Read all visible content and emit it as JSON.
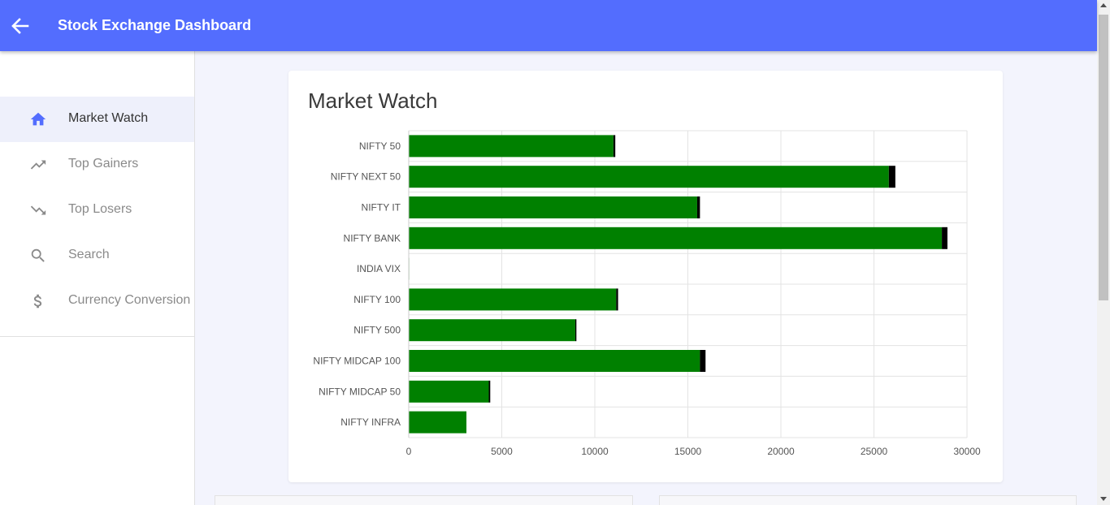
{
  "header": {
    "title": "Stock Exchange Dashboard",
    "back_icon": "arrow-left-icon"
  },
  "sidebar": {
    "items": [
      {
        "label": "Market Watch",
        "icon": "home-icon",
        "active": true
      },
      {
        "label": "Top Gainers",
        "icon": "trending-up-icon",
        "active": false
      },
      {
        "label": "Top Losers",
        "icon": "trending-down-icon",
        "active": false
      },
      {
        "label": "Search",
        "icon": "search-icon",
        "active": false
      },
      {
        "label": "Currency Conversion",
        "icon": "dollar-icon",
        "active": false
      }
    ]
  },
  "main": {
    "card_title": "Market Watch"
  },
  "colors": {
    "primary": "#536dfe",
    "bar": "#008000",
    "bar_cap": "#000000",
    "active_nav_bg": "#eef0fb"
  },
  "chart_data": {
    "type": "bar",
    "orientation": "horizontal",
    "stacked": true,
    "categories": [
      "NIFTY 50",
      "NIFTY NEXT 50",
      "NIFTY IT",
      "NIFTY BANK",
      "INDIA VIX",
      "NIFTY 100",
      "NIFTY 500",
      "NIFTY MIDCAP 100",
      "NIFTY MIDCAP 50",
      "NIFTY INFRA"
    ],
    "series": [
      {
        "color": "#008000",
        "values": [
          11000,
          25800,
          15500,
          28650,
          14,
          11150,
          8950,
          15650,
          4300,
          3100
        ]
      },
      {
        "color": "#000000",
        "values": [
          100,
          350,
          150,
          300,
          0,
          100,
          60,
          300,
          80,
          0
        ]
      }
    ],
    "xlim": [
      0,
      30000
    ],
    "xticks": [
      0,
      5000,
      10000,
      15000,
      20000,
      25000,
      30000
    ],
    "grid": true
  }
}
